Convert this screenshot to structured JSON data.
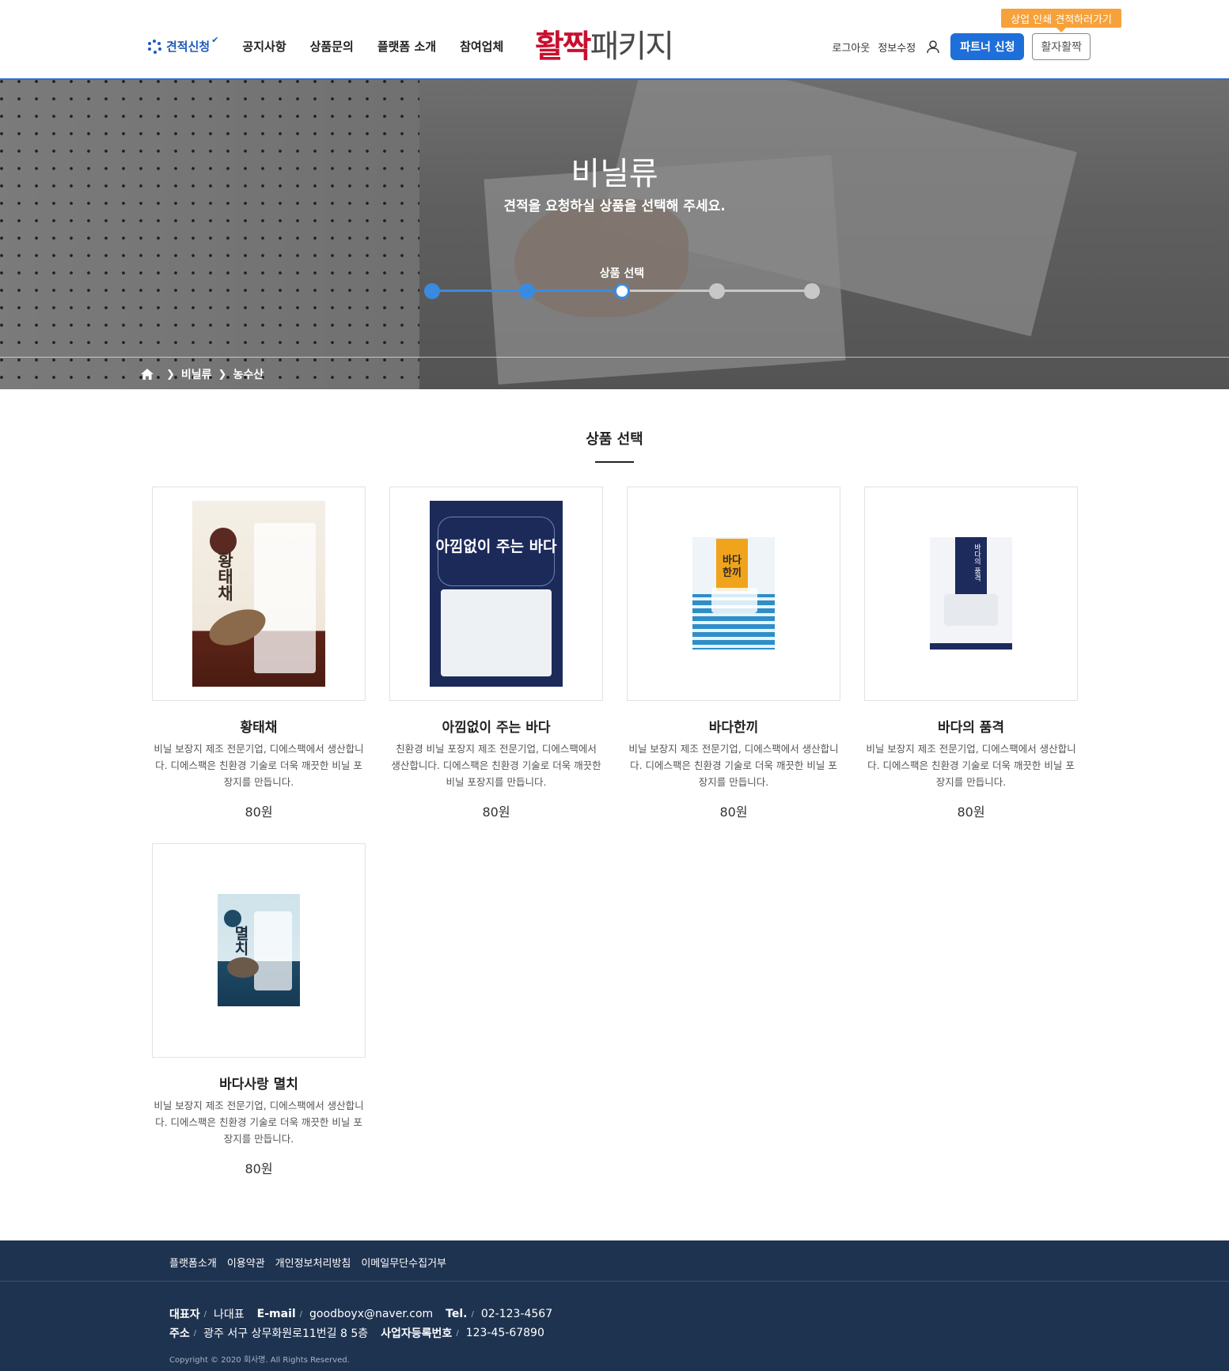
{
  "header": {
    "nav": [
      {
        "label": "견적신청",
        "active": true
      },
      {
        "label": "공지사항"
      },
      {
        "label": "상품문의"
      },
      {
        "label": "플랫폼 소개"
      },
      {
        "label": "참여업체"
      }
    ],
    "logo": {
      "red": "활짝",
      "gray": "패키지"
    },
    "util": {
      "logout": "로그아웃",
      "edit_info": "정보수정"
    },
    "partner_button": "파트너 신청",
    "promo_button": "활자활짝",
    "tooltip": "상업 인쇄 견적하러가기"
  },
  "hero": {
    "title": "비닐류",
    "subtitle": "견적을 요청하실 상품을 선택해 주세요.",
    "step_label": "상품 선택",
    "steps_total": 5,
    "current_step": 3
  },
  "breadcrumb": {
    "items": [
      "비닐류",
      "농수산"
    ]
  },
  "section": {
    "title": "상품 선택"
  },
  "products": [
    {
      "name": "황태채",
      "desc": "비닐 보장지 제조 전문기업, 디에스팩에서 생산합니다. 디에스팩은 친환경 기술로 더욱 깨끗한 비닐 포장지를 만듭니다.",
      "price": "80원",
      "pkg_text": "황태채"
    },
    {
      "name": "아낌없이 주는 바다",
      "desc": "친환경 비닐 포장지 제조 전문기업, 디에스팩에서 생산합니다. 디에스팩은 친환경 기술로 더욱 깨끗한 비닐 포장지를 만듭니다.",
      "price": "80원",
      "pkg_text": "아낌없이 주는 바다"
    },
    {
      "name": "바다한끼",
      "desc": "비닐 보장지 제조 전문기업, 디에스팩에서 생산합니다. 디에스팩은 친환경 기술로 더욱 깨끗한 비닐 포장지를 만듭니다.",
      "price": "80원",
      "pkg_text": "바다 한끼"
    },
    {
      "name": "바다의 품격",
      "desc": "비닐 보장지 제조 전문기업, 디에스팩에서 생산합니다. 디에스팩은 친환경 기술로 더욱 깨끗한 비닐 포장지를 만듭니다.",
      "price": "80원",
      "pkg_text": "바다의 품격"
    },
    {
      "name": "바다사랑 멸치",
      "desc": "비닐 보장지 제조 전문기업, 디에스팩에서 생산합니다. 디에스팩은 친환경 기술로 더욱 깨끗한 비닐 포장지를 만듭니다.",
      "price": "80원",
      "pkg_text": "멸치"
    }
  ],
  "footer": {
    "links": [
      "플랫폼소개",
      "이용약관",
      "개인정보처리방침",
      "이메일무단수집거부"
    ],
    "row1": [
      {
        "label": "대표자",
        "value": "나대표"
      },
      {
        "label": "E-mail",
        "value": "goodboyx@naver.com"
      },
      {
        "label": "Tel.",
        "value": "02-123-4567"
      }
    ],
    "row2": [
      {
        "label": "주소",
        "value": "광주 서구 상무화원로11번길 8 5층"
      },
      {
        "label": "사업자등록번호",
        "value": "123-45-67890"
      }
    ],
    "copyright": "Copyright © 2020 회사명. All Rights Reserved."
  },
  "colors": {
    "accent": "#1e6fd9",
    "brand_red": "#c8102e",
    "tooltip_orange": "#f7a13b",
    "footer_bg": "#1e3350"
  }
}
